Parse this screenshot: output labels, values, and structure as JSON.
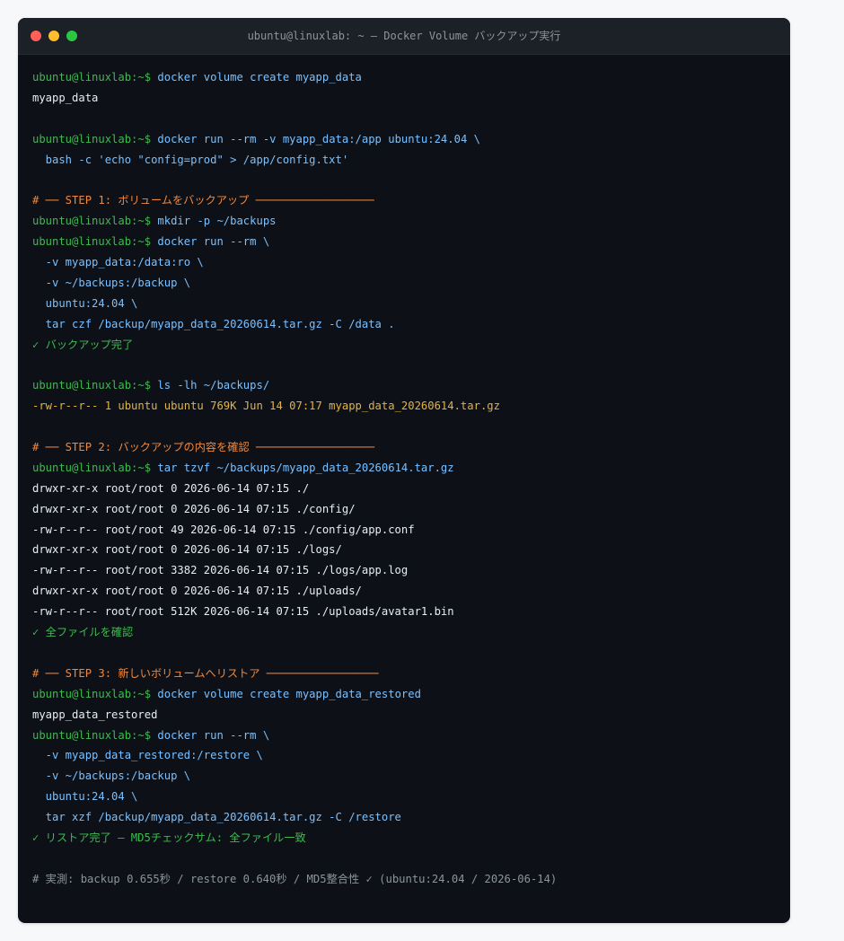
{
  "window": {
    "title": "ubuntu@linuxlab: ~ — Docker Volume バックアップ実行"
  },
  "colors": {
    "prompt": "#3fb950",
    "command": "#79c0ff",
    "output": "#e6edf3",
    "highlight": "#e3b341",
    "step_header": "#f0883e",
    "success": "#3fb950",
    "comment": "#8b949e",
    "background": "#0d1117"
  },
  "terminal": {
    "prompt": "ubuntu@linuxlab:~$",
    "lines": [
      {
        "type": "cmd",
        "text": "docker volume create myapp_data"
      },
      {
        "type": "out",
        "text": "myapp_data"
      },
      {
        "type": "blank",
        "text": ""
      },
      {
        "type": "cmd",
        "text": "docker run --rm -v myapp_data:/app ubuntu:24.04 \\"
      },
      {
        "type": "cont",
        "text": "  bash -c 'echo \"config=prod\" > /app/config.txt'"
      },
      {
        "type": "blank",
        "text": ""
      },
      {
        "type": "step",
        "text": "# ── STEP 1: ボリュームをバックアップ ──────────────────"
      },
      {
        "type": "cmd",
        "text": "mkdir -p ~/backups"
      },
      {
        "type": "cmd",
        "text": "docker run --rm \\"
      },
      {
        "type": "cont",
        "text": "  -v myapp_data:/data:ro \\"
      },
      {
        "type": "cont",
        "text": "  -v ~/backups:/backup \\"
      },
      {
        "type": "cont",
        "text": "  ubuntu:24.04 \\"
      },
      {
        "type": "cont",
        "text": "  tar czf /backup/myapp_data_20260614.tar.gz -C /data ."
      },
      {
        "type": "ok",
        "text": "✓ バックアップ完了"
      },
      {
        "type": "blank",
        "text": ""
      },
      {
        "type": "cmd",
        "text": "ls -lh ~/backups/"
      },
      {
        "type": "hl",
        "text": "-rw-r--r-- 1 ubuntu ubuntu 769K Jun 14 07:17 myapp_data_20260614.tar.gz"
      },
      {
        "type": "blank",
        "text": ""
      },
      {
        "type": "step",
        "text": "# ── STEP 2: バックアップの内容を確認 ──────────────────"
      },
      {
        "type": "cmd",
        "text": "tar tzvf ~/backups/myapp_data_20260614.tar.gz"
      },
      {
        "type": "out",
        "text": "drwxr-xr-x root/root 0 2026-06-14 07:15 ./"
      },
      {
        "type": "out",
        "text": "drwxr-xr-x root/root 0 2026-06-14 07:15 ./config/"
      },
      {
        "type": "out",
        "text": "-rw-r--r-- root/root 49 2026-06-14 07:15 ./config/app.conf"
      },
      {
        "type": "out",
        "text": "drwxr-xr-x root/root 0 2026-06-14 07:15 ./logs/"
      },
      {
        "type": "out",
        "text": "-rw-r--r-- root/root 3382 2026-06-14 07:15 ./logs/app.log"
      },
      {
        "type": "out",
        "text": "drwxr-xr-x root/root 0 2026-06-14 07:15 ./uploads/"
      },
      {
        "type": "out",
        "text": "-rw-r--r-- root/root 512K 2026-06-14 07:15 ./uploads/avatar1.bin"
      },
      {
        "type": "ok",
        "text": "✓ 全ファイルを確認"
      },
      {
        "type": "blank",
        "text": ""
      },
      {
        "type": "step",
        "text": "# ── STEP 3: 新しいボリュームへリストア ─────────────────"
      },
      {
        "type": "cmd",
        "text": "docker volume create myapp_data_restored"
      },
      {
        "type": "out",
        "text": "myapp_data_restored"
      },
      {
        "type": "cmd",
        "text": "docker run --rm \\"
      },
      {
        "type": "cont",
        "text": "  -v myapp_data_restored:/restore \\"
      },
      {
        "type": "cont",
        "text": "  -v ~/backups:/backup \\"
      },
      {
        "type": "cont",
        "text": "  ubuntu:24.04 \\"
      },
      {
        "type": "cont",
        "text": "  tar xzf /backup/myapp_data_20260614.tar.gz -C /restore"
      },
      {
        "type": "ok",
        "text": "✓ リストア完了 — MD5チェックサム: 全ファイル一致"
      },
      {
        "type": "blank",
        "text": ""
      },
      {
        "type": "comment",
        "text": "# 実測: backup 0.655秒 / restore 0.640秒 / MD5整合性 ✓ (ubuntu:24.04 / 2026-06-14)"
      }
    ]
  }
}
